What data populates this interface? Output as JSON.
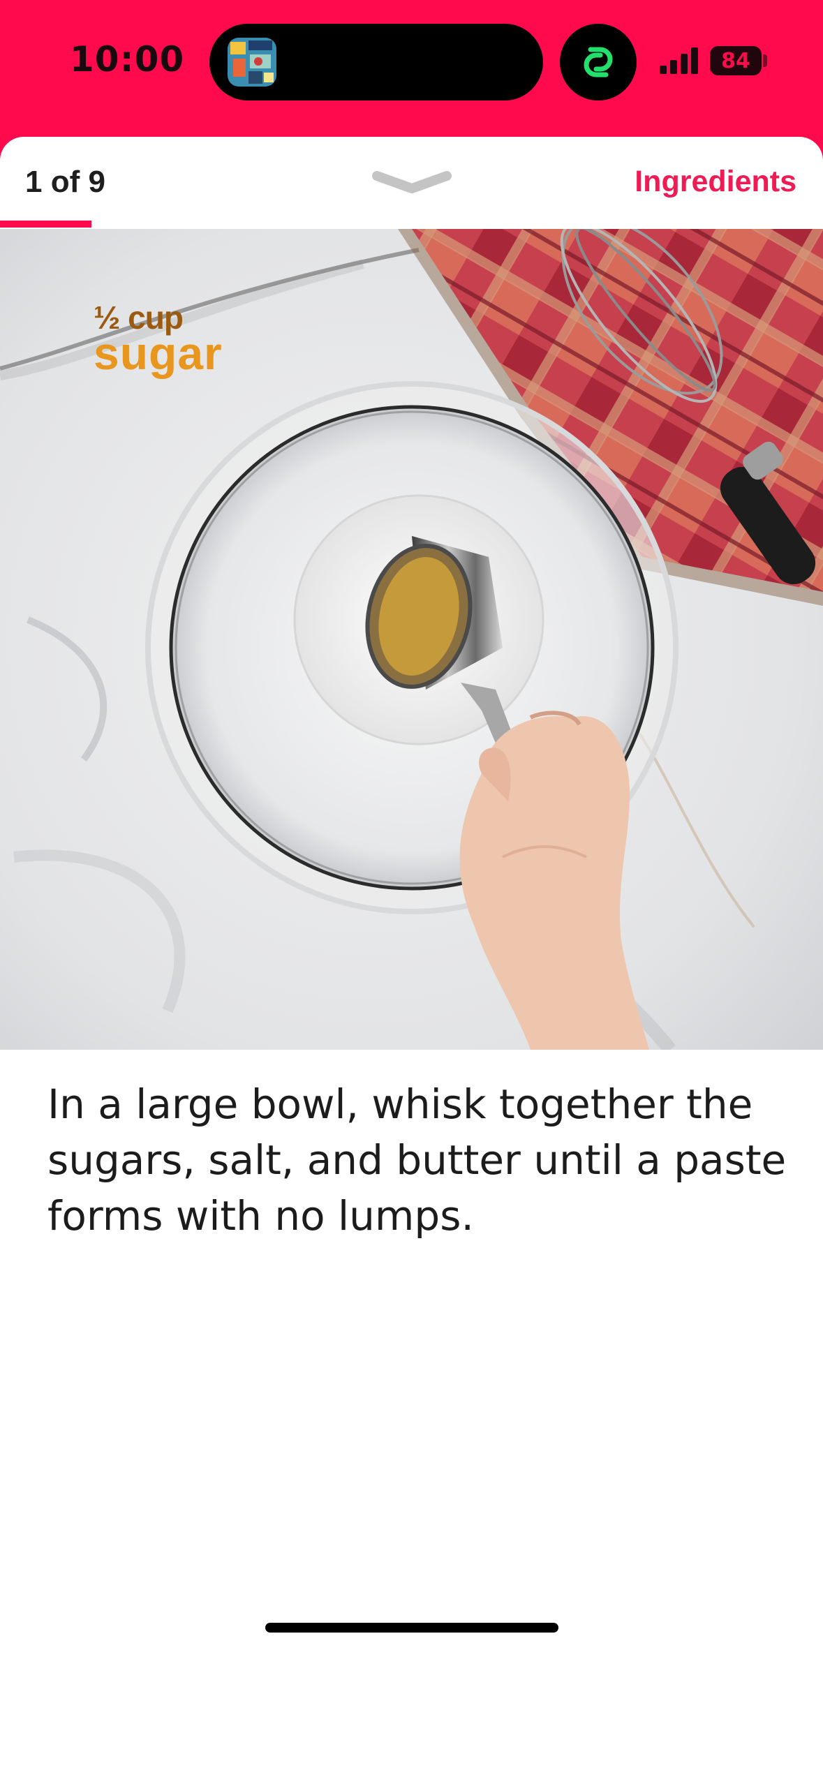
{
  "status_bar": {
    "time": "10:00",
    "battery_level": "84",
    "signal_bars": 4,
    "now_playing_icon": "album-art-icon",
    "link_icon": "link-rings-icon"
  },
  "header": {
    "step_counter": "1 of 9",
    "ingredients_label": "Ingredients",
    "progress_fraction": 0.111,
    "accent_color": "#ff0a4c"
  },
  "media": {
    "overlay_quantity": "½ cup",
    "overlay_ingredient": "sugar"
  },
  "step": {
    "instruction": "In a large bowl, whisk together the sugars, salt, and butter until a paste forms with no lumps."
  }
}
